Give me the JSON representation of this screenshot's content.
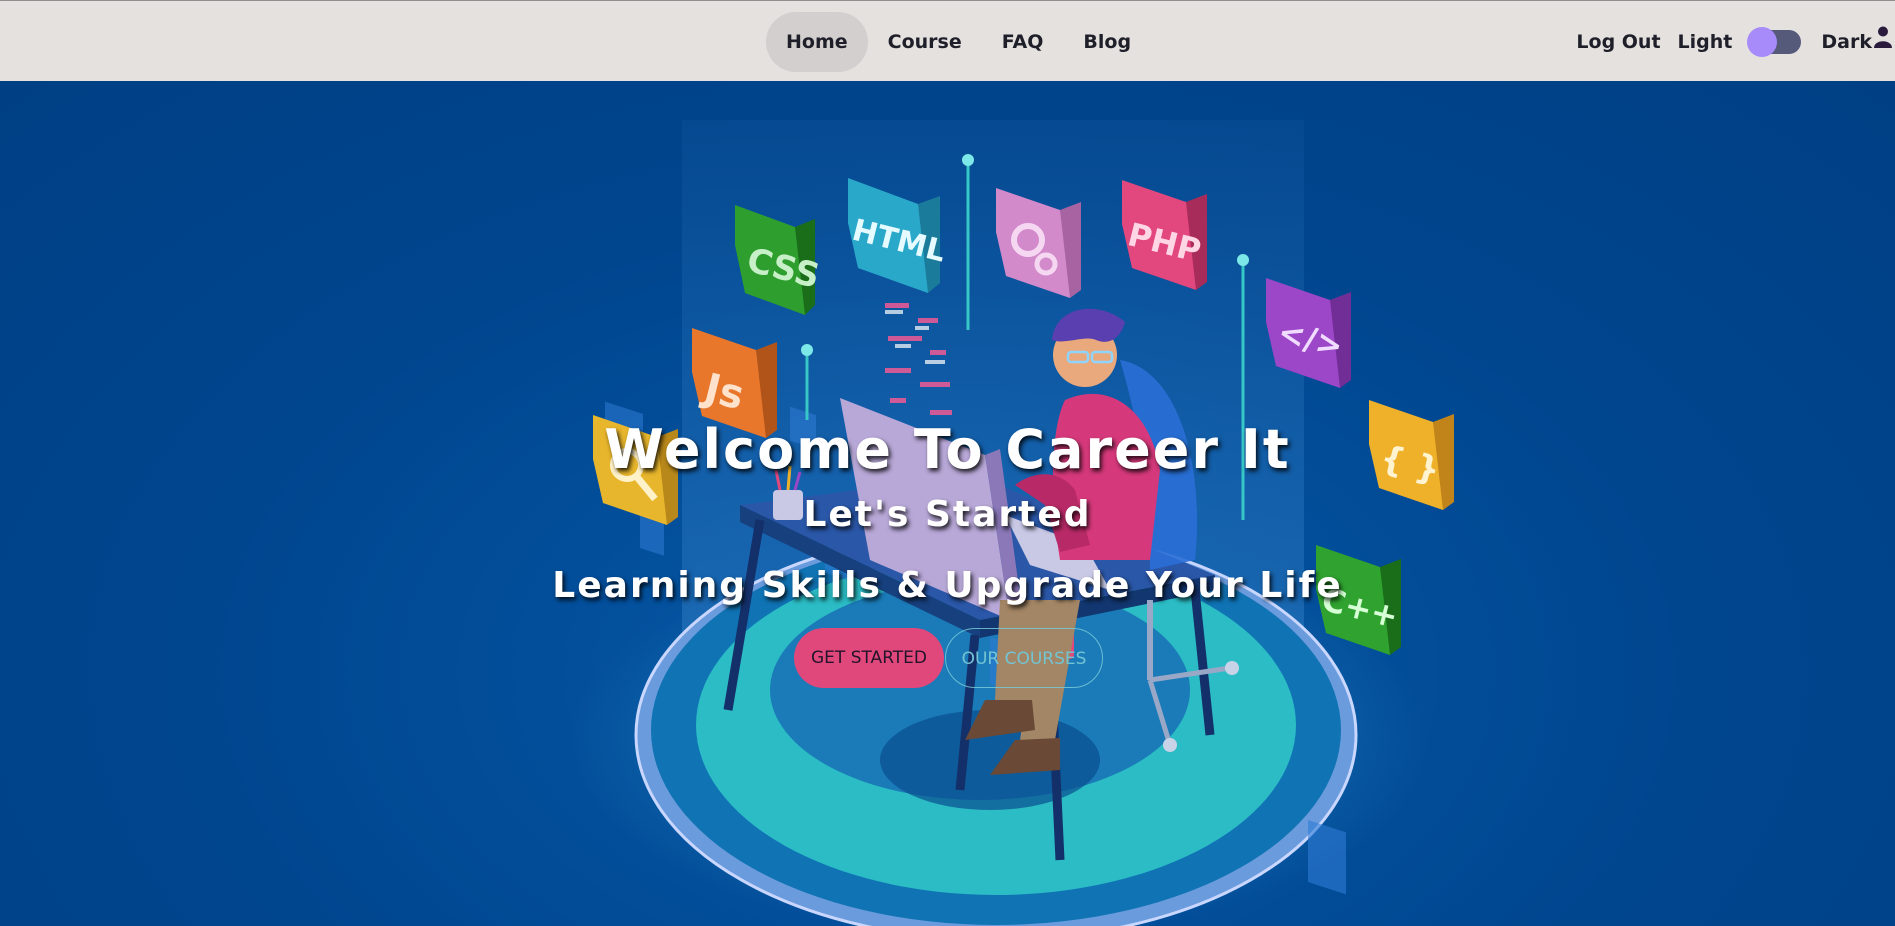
{
  "nav": {
    "links": [
      "Home",
      "Course",
      "FAQ",
      "Blog"
    ],
    "active": "Home",
    "logout_label": "Log Out",
    "light_label": "Light",
    "dark_label": "Dark",
    "theme_toggle_icon": "toggle-switch",
    "user_icon": "user-icon"
  },
  "hero": {
    "title": "Welcome To Career It",
    "subtitle": "Let's Started",
    "tagline": "Learning Skills & Upgrade Your Life",
    "primary_button": "GET STARTED",
    "secondary_button": "OUR COURSES",
    "illustration_labels": [
      "CSS",
      "HTML",
      "PHP",
      "Js",
      "</>",
      "{ }",
      "C++"
    ]
  },
  "colors": {
    "navbar_bg": "#e4e1df",
    "hero_bg": "#00438a",
    "primary_button": "#e0487c",
    "secondary_button_border": "#73c4d3",
    "toggle_knob": "#a78bfa"
  }
}
